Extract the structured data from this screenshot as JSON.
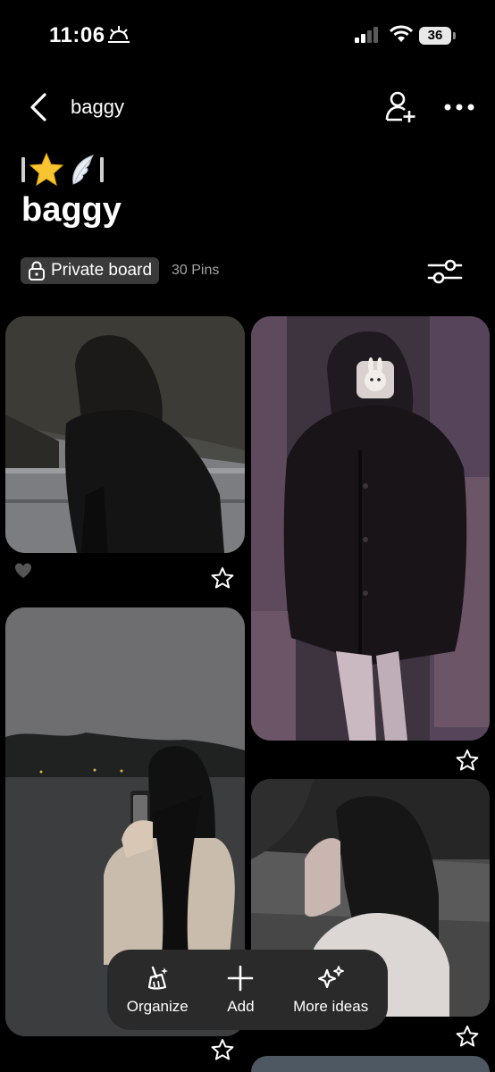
{
  "status": {
    "time": "11:06",
    "battery": "36"
  },
  "nav": {
    "title": "baggy"
  },
  "board": {
    "emoji_title": "|⭐🪽|",
    "title": "baggy",
    "privacy_label": "Private board",
    "pin_count": "30 Pins"
  },
  "pins": [
    {
      "reaction": "heart",
      "saved": false
    },
    {
      "saved": false
    },
    {
      "saved": false
    },
    {
      "saved": false
    }
  ],
  "actions": [
    {
      "label": "Organize",
      "icon": "broom-sparkle-icon"
    },
    {
      "label": "Add",
      "icon": "plus-icon"
    },
    {
      "label": "More ideas",
      "icon": "sparkles-icon"
    }
  ],
  "colors": {
    "background": "#000000",
    "badge_bg": "#3a3a3a",
    "action_bar_bg": "#2a2a2a",
    "muted_text": "#a5a5a5"
  }
}
